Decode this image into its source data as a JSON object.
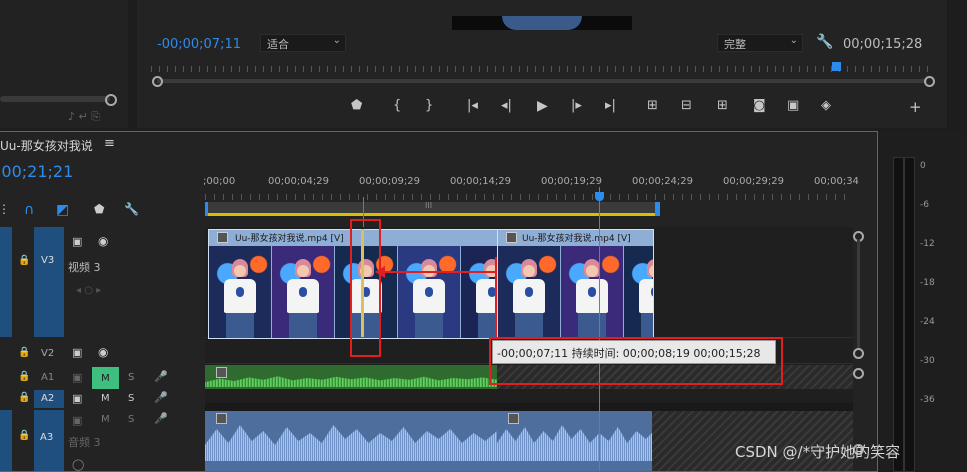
{
  "program_monitor": {
    "playhead_time": "-00;00;07;11",
    "fit_select": "适合",
    "quality_select": "完整",
    "duration": "00;00;15;28"
  },
  "transport_icons": [
    "marker-icon",
    "in-point-icon",
    "out-point-icon",
    "go-to-in-icon",
    "step-back-icon",
    "play-icon",
    "step-forward-icon",
    "go-to-out-icon",
    "lift-icon",
    "extract-icon",
    "insert-icon",
    "export-frame-icon",
    "compare-icon",
    "vr-icon",
    "add-icon"
  ],
  "timeline": {
    "sequence_name": "Uu-那女孩对我说",
    "menu_glyph": "≡",
    "timecode": ";00;21;21",
    "ruler_ticks": [
      ";00;00",
      "00;00;04;29",
      "00;00;09;29",
      "00;00;14;29",
      "00;00;19;29",
      "00;00;24;29",
      "00;00;29;29",
      "00;00;34"
    ],
    "work_area_handle": "III"
  },
  "tracks": {
    "v3": {
      "label": "V3",
      "name": "视频 3"
    },
    "v2": {
      "label": "V2"
    },
    "a1": {
      "label": "A1",
      "mute": "M",
      "solo": "S"
    },
    "a2": {
      "label": "A2",
      "mute": "M",
      "solo": "S"
    },
    "a3": {
      "label": "A3",
      "name": "音频 3"
    }
  },
  "clips": {
    "clip1_label": "Uu-那女孩对我说.mp4 [V]",
    "clip2_label": "Uu-那女孩对我说.mp4 [V]"
  },
  "tooltip": {
    "text": "-00;00;07;11 持续时间: 00;00;08;19 00;00;15;28"
  },
  "meter": {
    "scale": [
      "0",
      "-6",
      "-12",
      "-18",
      "-24",
      "-30",
      "-36"
    ]
  },
  "watermark": "CSDN @/*守护她的笑容",
  "colors": {
    "accent_blue": "#2d8ceb",
    "clip_video": "#8faed6",
    "audio_green": "#3b8f3b",
    "audio_blue": "#5c7fb0",
    "annotation_red": "#e02020",
    "mute_green": "#3fbf7f"
  }
}
